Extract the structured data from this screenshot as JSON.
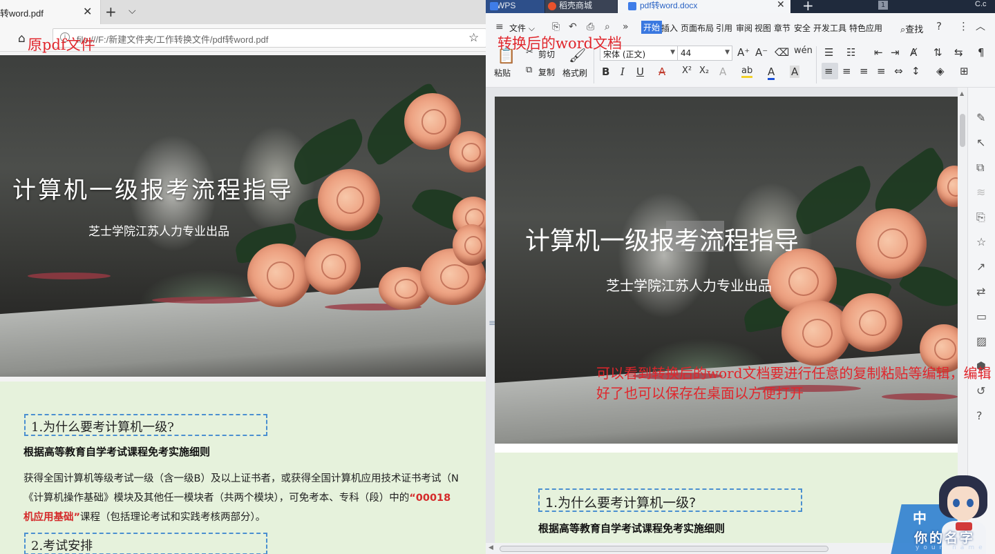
{
  "browser": {
    "tab_title": "转word.pdf",
    "close_glyph": "✕",
    "new_tab_glyph": "+",
    "tab_menu_glyph": "⌵",
    "home_glyph": "⌂",
    "star_glyph": "☆",
    "info_glyph": "i",
    "url": "file:///F:/新建文件夹/工作转换文件/pdf转word.pdf"
  },
  "annotations": {
    "original_pdf": "原pdf文件",
    "converted_word": "转换后的word文档",
    "edit_note": "可以看到转换后的word文档要进行任意的复制粘贴等编辑，编辑好了也可以保存在桌面以方便打开"
  },
  "pdf": {
    "title": "计算机一级报考流程指导",
    "subtitle": "芝士学院江苏人力专业出品",
    "section1": "1.为什么要考计算机一级?",
    "heading": "根据高等教育自学考试课程免考实施细则",
    "para_line1": "获得全国计算机等级考试一级（含一级B）及以上证书者，或获得全国计算机应用技术证书考试（N",
    "para_line2a": "《计算机操作基础》模块及其他任一模块者（共两个模块），可免考本、专科（段）中的",
    "para_line2b": "“00018",
    "para_line3a": "机应用基础”",
    "para_line3b": "课程（包括理论考试和实践考核两部分）。",
    "section2": "2.考试安排"
  },
  "wps": {
    "tabs": [
      "WPS",
      "稻壳商城",
      "pdf转word.docx"
    ],
    "plus_glyph": "+",
    "window_count": "1",
    "user": "C.c",
    "menu_file": "文件",
    "menu_file_arrow": "⌵",
    "menus": [
      "开始",
      "插入",
      "页面布局",
      "引用",
      "审阅",
      "视图",
      "章节",
      "安全",
      "开发工具",
      "特色应用"
    ],
    "search": "查找",
    "quick_icons": [
      "⎘",
      "↶",
      "⎙",
      "⌕",
      "»"
    ],
    "help_glyph": "?",
    "more_glyph": "⋮",
    "collapse_glyph": "︿",
    "ribbon": {
      "paste": "粘贴",
      "cut": "剪切",
      "copy": "复制",
      "format_painter": "格式刷",
      "font_name": "宋体 (正文)",
      "font_size": "44",
      "bold": "B",
      "italic": "I",
      "underline": "U",
      "superscript": "X²",
      "subscript": "X₂",
      "grow_font": "A⁺",
      "shrink_font": "A⁻",
      "char_border": "A",
      "font_color": "A",
      "highlight": "ab",
      "strike": "A"
    }
  },
  "doc": {
    "title": "计算机一级报考流程指导",
    "subtitle": "芝士学院江苏人力专业出品",
    "section1": "1.为什么要考计算机一级?",
    "heading": "根据高等教育自学考试课程免考实施细则",
    "para_mark": "≡"
  },
  "sidebar_icons": [
    "✎",
    "↖",
    "⧉",
    "≋",
    "⎘",
    "☆",
    "↗",
    "⇄",
    "▭",
    "▨",
    "⬢",
    "↺",
    "?"
  ],
  "watermark": {
    "mid": "中",
    "name": "你的名字",
    "sub": "your name"
  }
}
